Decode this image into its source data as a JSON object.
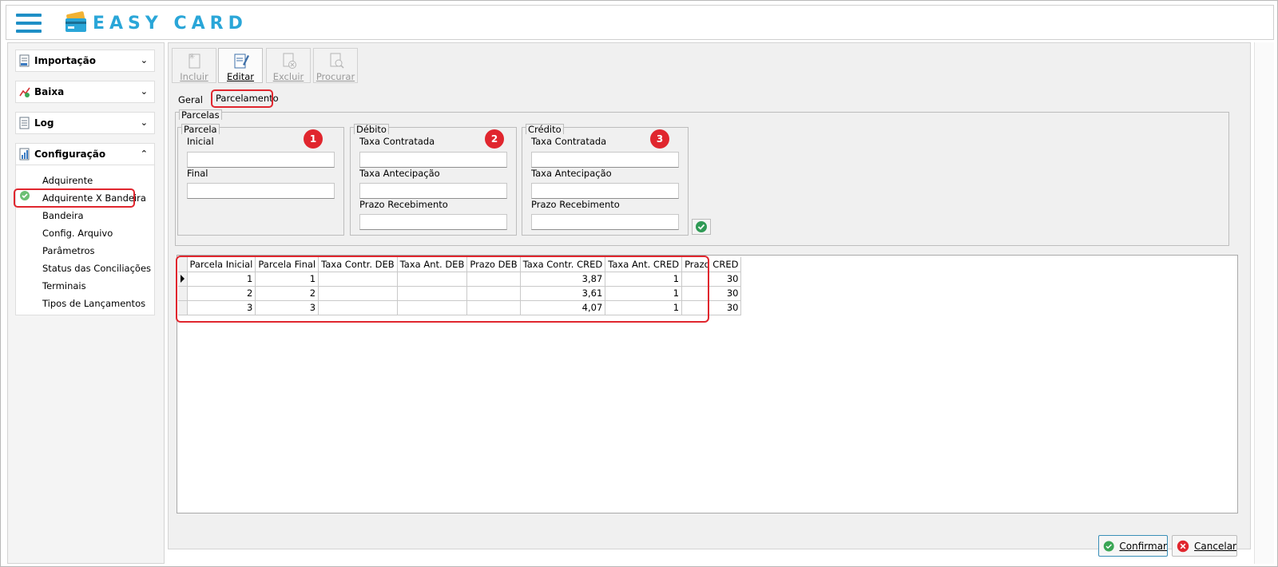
{
  "app": {
    "logo_text": "EASY CARD",
    "accent": "#2aa6d8",
    "highlight_color": "#e0262e"
  },
  "sidebar": {
    "sections": [
      {
        "label": "Importação",
        "icon": "import-doc-icon",
        "expanded": false
      },
      {
        "label": "Baixa",
        "icon": "baixa-chart-icon",
        "expanded": false
      },
      {
        "label": "Log",
        "icon": "log-doc-icon",
        "expanded": false
      },
      {
        "label": "Configuração",
        "icon": "config-icon",
        "expanded": true
      }
    ],
    "items": [
      {
        "label": "Adquirente"
      },
      {
        "label": "Adquirente X Bandeira",
        "selected": true
      },
      {
        "label": "Bandeira"
      },
      {
        "label": "Config. Arquivo"
      },
      {
        "label": "Parâmetros"
      },
      {
        "label": "Status das Conciliações"
      },
      {
        "label": "Terminais"
      },
      {
        "label": "Tipos de Lançamentos"
      }
    ]
  },
  "toolbar": {
    "incluir": "Incluir",
    "editar": "Editar",
    "excluir": "Excluir",
    "procurar": "Procurar"
  },
  "tabs": {
    "geral": "Geral",
    "parcelamento": "Parcelamento"
  },
  "form": {
    "group_title": "Parcelas",
    "parcela": {
      "title": "Parcela",
      "inicial": "Inicial",
      "final": "Final",
      "badge": "1"
    },
    "debito": {
      "title": "Débito",
      "taxa_contratada": "Taxa Contratada",
      "taxa_antecipacao": "Taxa Antecipação",
      "prazo_recebimento": "Prazo Recebimento",
      "badge": "2"
    },
    "credito": {
      "title": "Crédito",
      "taxa_contratada": "Taxa Contratada",
      "taxa_antecipacao": "Taxa Antecipação",
      "prazo_recebimento": "Prazo Recebimento",
      "badge": "3"
    }
  },
  "grid": {
    "columns": [
      "Parcela Inicial",
      "Parcela Final",
      "Taxa Contr. DEB",
      "Taxa Ant. DEB",
      "Prazo DEB",
      "Taxa Contr. CRED",
      "Taxa Ant. CRED",
      "Prazo CRED"
    ],
    "rows": [
      [
        "1",
        "1",
        "",
        "",
        "",
        "3,87",
        "1",
        "30"
      ],
      [
        "2",
        "2",
        "",
        "",
        "",
        "3,61",
        "1",
        "30"
      ],
      [
        "3",
        "3",
        "",
        "",
        "",
        "4,07",
        "1",
        "30"
      ]
    ],
    "selected_row": 0
  },
  "buttons": {
    "confirmar": "Confirmar",
    "cancelar": "Cancelar"
  }
}
